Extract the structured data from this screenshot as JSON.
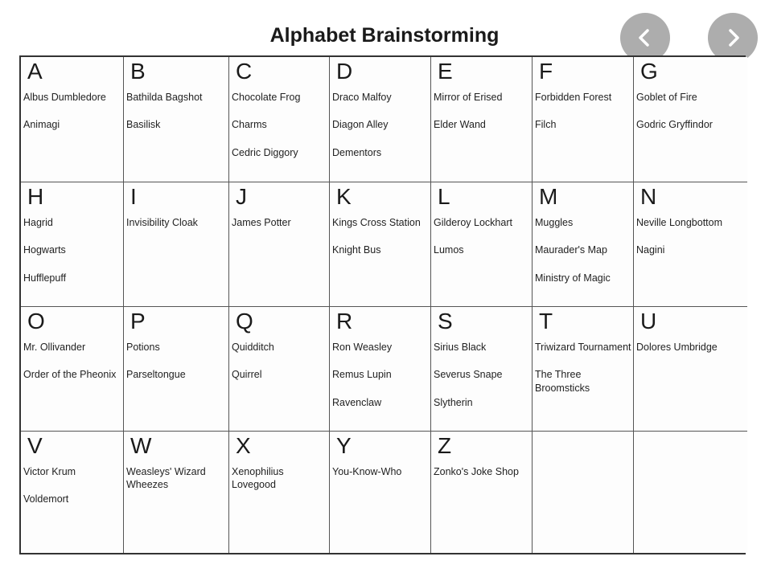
{
  "title": "Alphabet Brainstorming",
  "nav": {
    "prev_icon": "chevron-left-icon",
    "next_icon": "chevron-right-icon",
    "button_color": "#969696"
  },
  "cells": [
    {
      "letter": "A",
      "entries": [
        "Albus Dumbledore",
        "Animagi"
      ]
    },
    {
      "letter": "B",
      "entries": [
        "Bathilda Bagshot",
        "Basilisk"
      ]
    },
    {
      "letter": "C",
      "entries": [
        "Chocolate Frog",
        "Charms",
        "Cedric Diggory"
      ]
    },
    {
      "letter": "D",
      "entries": [
        "Draco Malfoy",
        "Diagon Alley",
        "Dementors"
      ]
    },
    {
      "letter": "E",
      "entries": [
        "Mirror of Erised",
        "Elder Wand"
      ]
    },
    {
      "letter": "F",
      "entries": [
        "Forbidden Forest",
        "Filch"
      ]
    },
    {
      "letter": "G",
      "entries": [
        "Goblet of Fire",
        "Godric Gryffindor"
      ]
    },
    {
      "letter": "H",
      "entries": [
        "Hagrid",
        "Hogwarts",
        "Hufflepuff"
      ]
    },
    {
      "letter": "I",
      "entries": [
        "Invisibility Cloak"
      ]
    },
    {
      "letter": "J",
      "entries": [
        "James Potter"
      ]
    },
    {
      "letter": "K",
      "entries": [
        "Kings Cross Station",
        "Knight Bus"
      ]
    },
    {
      "letter": "L",
      "entries": [
        "Gilderoy Lockhart",
        "Lumos"
      ]
    },
    {
      "letter": "M",
      "entries": [
        "Muggles",
        "Maurader's Map",
        "Ministry of Magic"
      ]
    },
    {
      "letter": "N",
      "entries": [
        "Neville Longbottom",
        "Nagini"
      ]
    },
    {
      "letter": "O",
      "entries": [
        "Mr. Ollivander",
        "Order of the Pheonix"
      ]
    },
    {
      "letter": "P",
      "entries": [
        "Potions",
        "Parseltongue"
      ]
    },
    {
      "letter": "Q",
      "entries": [
        "Quidditch",
        "Quirrel"
      ]
    },
    {
      "letter": "R",
      "entries": [
        "Ron Weasley",
        "Remus Lupin",
        "Ravenclaw"
      ]
    },
    {
      "letter": "S",
      "entries": [
        "Sirius Black",
        "Severus Snape",
        "Slytherin"
      ]
    },
    {
      "letter": "T",
      "entries": [
        "Triwizard Tournament",
        "The Three Broomsticks"
      ]
    },
    {
      "letter": "U",
      "entries": [
        "Dolores Umbridge"
      ]
    },
    {
      "letter": "V",
      "entries": [
        "Victor Krum",
        "Voldemort"
      ]
    },
    {
      "letter": "W",
      "entries": [
        "Weasleys' Wizard Wheezes"
      ]
    },
    {
      "letter": "X",
      "entries": [
        "Xenophilius Lovegood"
      ]
    },
    {
      "letter": "Y",
      "entries": [
        "You-Know-Who"
      ]
    },
    {
      "letter": "Z",
      "entries": [
        "Zonko's Joke Shop"
      ]
    },
    {
      "letter": "",
      "entries": []
    },
    {
      "letter": "",
      "entries": []
    }
  ]
}
